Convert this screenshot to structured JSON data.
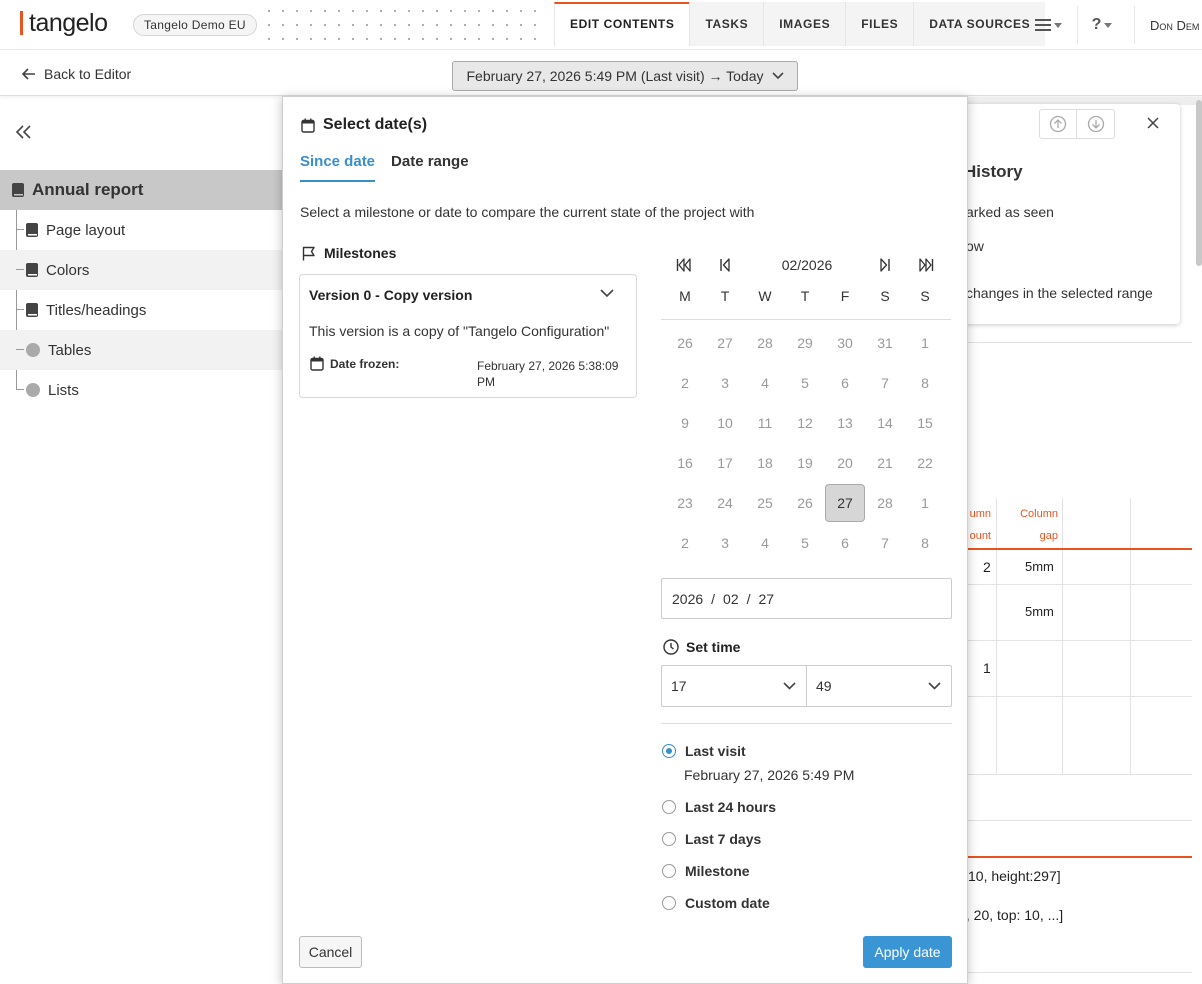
{
  "header": {
    "logo_text": "tangelo",
    "org_badge": "Tangelo Demo EU",
    "nav_tabs": [
      "EDIT CONTENTS",
      "TASKS",
      "IMAGES",
      "FILES",
      "DATA SOURCES"
    ],
    "active_tab": "EDIT CONTENTS",
    "help_label": "?",
    "user_name": "Don Dem"
  },
  "subbar": {
    "back_label": "Back to Editor",
    "date_range_label": "February 27, 2026 5:49 PM (Last visit) → Today"
  },
  "sidebar": {
    "root": "Annual report",
    "items": [
      {
        "label": "Page layout",
        "icon": "book-icon"
      },
      {
        "label": "Colors",
        "icon": "book-icon"
      },
      {
        "label": "Titles/headings",
        "icon": "book-icon"
      },
      {
        "label": "Tables",
        "icon": "circle-icon"
      },
      {
        "label": "Lists",
        "icon": "circle-icon"
      }
    ]
  },
  "background": {
    "history_title": "History",
    "history_line1": "arked as seen",
    "history_line2": "ow",
    "history_line3": "changes in the selected range",
    "col_head_1a": "umn",
    "col_head_1b": "ount",
    "col_head_2a": "Column",
    "col_head_2b": "gap",
    "cell_2": "2",
    "cell_5mm_a": "5mm",
    "cell_5mm_b": "5mm",
    "cell_1": "1",
    "text_a": "10, height:297]",
    "text_b": "t, 20, top: 10, ...]"
  },
  "dialog": {
    "title": "Select date(s)",
    "tabs": [
      "Since date",
      "Date range"
    ],
    "active_tab": "Since date",
    "intro": "Select a milestone or date to compare the current state of the project with",
    "milestones_label": "Milestones",
    "milestone": {
      "name": "Version 0 - Copy version",
      "description": "This version is a copy of \"Tangelo Configuration\"",
      "frozen_label": "Date frozen:",
      "frozen_value": "February 27, 2026 5:38:09 PM"
    },
    "calendar": {
      "month": "02/2026",
      "weekdays": [
        "M",
        "T",
        "W",
        "T",
        "F",
        "S",
        "S"
      ],
      "days": [
        [
          "26",
          "27",
          "28",
          "29",
          "30",
          "31",
          "1"
        ],
        [
          "2",
          "3",
          "4",
          "5",
          "6",
          "7",
          "8"
        ],
        [
          "9",
          "10",
          "11",
          "12",
          "13",
          "14",
          "15"
        ],
        [
          "16",
          "17",
          "18",
          "19",
          "20",
          "21",
          "22"
        ],
        [
          "23",
          "24",
          "25",
          "26",
          "27",
          "28",
          "1"
        ],
        [
          "2",
          "3",
          "4",
          "5",
          "6",
          "7",
          "8"
        ]
      ],
      "selected_day": "27"
    },
    "date_input": {
      "year": "2026",
      "month": "02",
      "day": "27"
    },
    "set_time_label": "Set time",
    "hour": "17",
    "minute": "49",
    "options": [
      {
        "label": "Last visit",
        "sub": "February 27, 2026 5:49 PM",
        "selected": true
      },
      {
        "label": "Last 24 hours",
        "selected": false
      },
      {
        "label": "Last 7 days",
        "selected": false
      },
      {
        "label": "Milestone",
        "selected": false
      },
      {
        "label": "Custom date",
        "selected": false
      }
    ],
    "cancel_label": "Cancel",
    "apply_label": "Apply date"
  },
  "colors": {
    "accent": "#e8541f",
    "primary": "#3a95d5",
    "selected_day_bg": "#d6d6d6"
  }
}
